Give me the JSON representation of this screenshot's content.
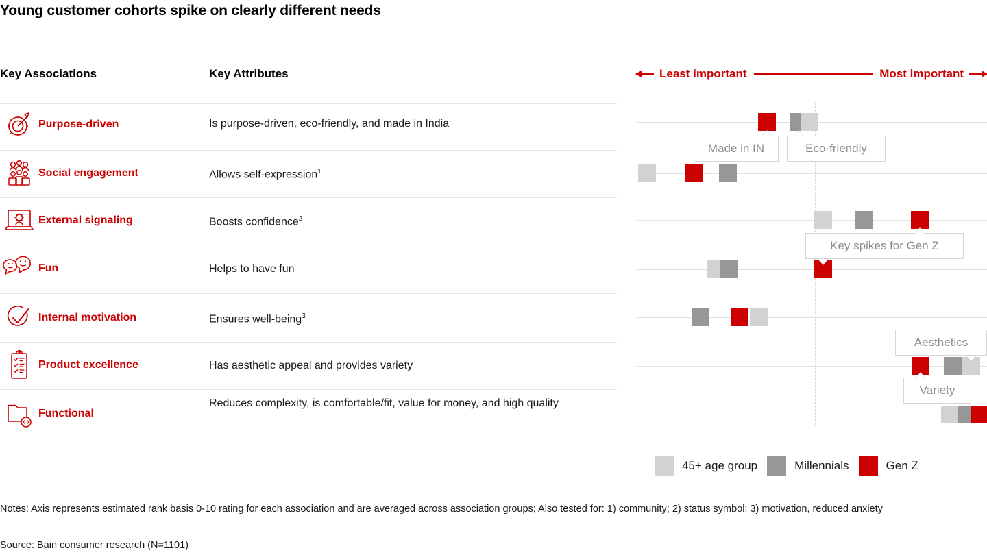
{
  "title": "Young customer cohorts spike on clearly different needs",
  "columns": {
    "associations": "Key Associations",
    "attributes": "Key Attributes"
  },
  "axis": {
    "least": "Least important",
    "most": "Most important"
  },
  "rows": [
    {
      "icon": "target-gear-arrow-icon",
      "association": "Purpose-driven",
      "attribute": "Is purpose-driven, eco-friendly, and made in India"
    },
    {
      "icon": "people-group-icon",
      "association": "Social engagement",
      "attribute": "Allows self-expression",
      "attribute_sup": "1"
    },
    {
      "icon": "laptop-gear-icon",
      "association": "External signaling",
      "attribute": "Boosts confidence",
      "attribute_sup": "2"
    },
    {
      "icon": "speech-bubbles-smiley-icon",
      "association": "Fun",
      "attribute": "Helps to have fun"
    },
    {
      "icon": "checkmark-circle-icon",
      "association": "Internal motivation",
      "attribute": "Ensures well-being",
      "attribute_sup": "3"
    },
    {
      "icon": "clipboard-checklist-icon",
      "association": "Product excellence",
      "attribute": "Has aesthetic appeal and provides variety"
    },
    {
      "icon": "folder-code-icon",
      "association": "Functional",
      "attribute": "Reduces complexity, is comfortable/fit, value for money, and high quality"
    }
  ],
  "legend": [
    {
      "label": "45+ age group",
      "color": "#d2d2d2"
    },
    {
      "label": "Millennials",
      "color": "#979797"
    },
    {
      "label": "Gen Z",
      "color": "#cc0000"
    }
  ],
  "callouts": [
    {
      "text": "Made in IN"
    },
    {
      "text": "Eco-friendly"
    },
    {
      "text": "Key spikes for Gen Z"
    },
    {
      "text": "Aesthetics"
    },
    {
      "text": "Variety"
    }
  ],
  "notes": "Notes: Axis represents estimated rank basis 0-10 rating for each association and are averaged across association groups;  Also tested for: 1) community; 2) status symbol; 3) motivation, reduced anxiety",
  "source": "Source: Bain consumer research (N=1101)",
  "colors": {
    "accent_red": "#cc0000",
    "gen_z": "#cc0000",
    "millennials": "#979797",
    "age45plus": "#d2d2d2",
    "track": "#e0e0e0"
  },
  "chart_data": {
    "type": "scatter",
    "title": "Young customer cohorts spike on clearly different needs",
    "xlabel": "Least important  ↔  Most important",
    "ylabel": "Key Associations",
    "xlim": [
      0,
      10
    ],
    "grid": false,
    "legend_position": "bottom-right",
    "categories": [
      "Purpose-driven",
      "Social engagement",
      "External signaling",
      "Fun",
      "Internal motivation",
      "Product excellence",
      "Functional"
    ],
    "series": [
      {
        "name": "45+ age group",
        "color": "#d2d2d2",
        "values": [
          4.9,
          0.3,
          5.4,
          2.4,
          3.6,
          9.6,
          8.9
        ]
      },
      {
        "name": "Millennials",
        "color": "#979797",
        "values": [
          4.6,
          2.7,
          6.5,
          2.7,
          1.9,
          9.1,
          9.4
        ]
      },
      {
        "name": "Gen Z",
        "color": "#cc0000",
        "values": [
          3.7,
          1.7,
          8.1,
          5.4,
          3.0,
          8.1,
          9.8
        ]
      }
    ],
    "annotations": [
      {
        "text": "Made in IN",
        "series": "Gen Z",
        "category": "Purpose-driven"
      },
      {
        "text": "Eco-friendly",
        "series": "Millennials",
        "category": "Purpose-driven"
      },
      {
        "text": "Key spikes for Gen Z",
        "series": "Gen Z",
        "categories": [
          "External signaling",
          "Fun"
        ]
      },
      {
        "text": "Aesthetics",
        "series": "45+ age group",
        "category": "Product excellence"
      },
      {
        "text": "Variety",
        "series": "Gen Z",
        "category": "Product excellence"
      }
    ]
  }
}
